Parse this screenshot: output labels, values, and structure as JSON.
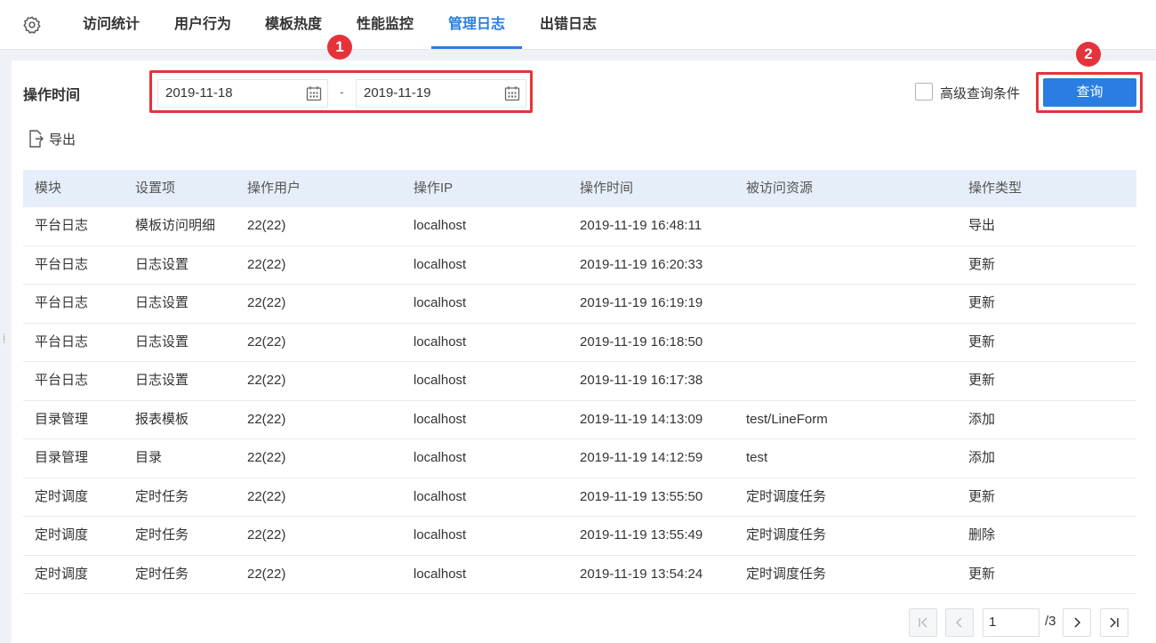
{
  "tabs": [
    {
      "label": "访问统计"
    },
    {
      "label": "用户行为"
    },
    {
      "label": "模板热度"
    },
    {
      "label": "性能监控"
    },
    {
      "label": "管理日志",
      "active": true
    },
    {
      "label": "出错日志"
    }
  ],
  "filter": {
    "time_label": "操作时间",
    "start_date": "2019-11-18",
    "end_date": "2019-11-19",
    "separator": "-",
    "advanced_label": "高级查询条件",
    "query_button": "查询"
  },
  "annotations": {
    "badge1": "1",
    "badge2": "2"
  },
  "export_label": "导出",
  "table": {
    "headers": [
      "模块",
      "设置项",
      "操作用户",
      "操作IP",
      "操作时间",
      "被访问资源",
      "操作类型"
    ],
    "rows": [
      [
        "平台日志",
        "模板访问明细",
        "22(22)",
        "localhost",
        "2019-11-19 16:48:11",
        "",
        "导出"
      ],
      [
        "平台日志",
        "日志设置",
        "22(22)",
        "localhost",
        "2019-11-19 16:20:33",
        "",
        "更新"
      ],
      [
        "平台日志",
        "日志设置",
        "22(22)",
        "localhost",
        "2019-11-19 16:19:19",
        "",
        "更新"
      ],
      [
        "平台日志",
        "日志设置",
        "22(22)",
        "localhost",
        "2019-11-19 16:18:50",
        "",
        "更新"
      ],
      [
        "平台日志",
        "日志设置",
        "22(22)",
        "localhost",
        "2019-11-19 16:17:38",
        "",
        "更新"
      ],
      [
        "目录管理",
        "报表模板",
        "22(22)",
        "localhost",
        "2019-11-19 14:13:09",
        "test/LineForm",
        "添加"
      ],
      [
        "目录管理",
        "目录",
        "22(22)",
        "localhost",
        "2019-11-19 14:12:59",
        "test",
        "添加"
      ],
      [
        "定时调度",
        "定时任务",
        "22(22)",
        "localhost",
        "2019-11-19 13:55:50",
        "定时调度任务",
        "更新"
      ],
      [
        "定时调度",
        "定时任务",
        "22(22)",
        "localhost",
        "2019-11-19 13:55:49",
        "定时调度任务",
        "删除"
      ],
      [
        "定时调度",
        "定时任务",
        "22(22)",
        "localhost",
        "2019-11-19 13:54:24",
        "定时调度任务",
        "更新"
      ]
    ]
  },
  "pagination": {
    "current": "1",
    "total": "/3"
  },
  "colors": {
    "accent": "#2a7de1",
    "highlight": "#e5333b"
  }
}
